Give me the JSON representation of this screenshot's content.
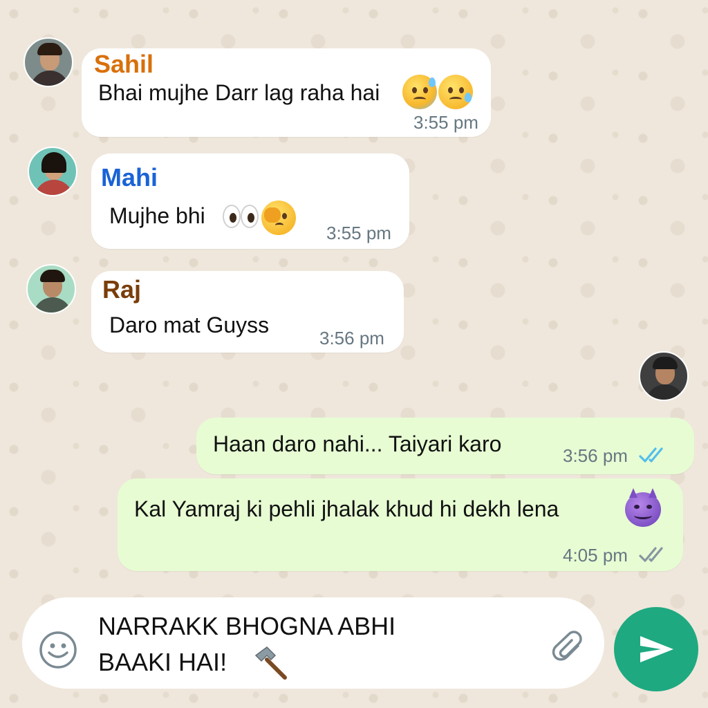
{
  "colors": {
    "chat_background": "#efe7dc",
    "incoming_bubble": "#ffffff",
    "outgoing_bubble": "#e7fcd3",
    "send_button": "#1ea981",
    "read_ticks": "#53bdeb",
    "delivered_ticks": "#8696a0"
  },
  "messages": [
    {
      "direction": "incoming",
      "sender": "Sahil",
      "sender_color": "#d9700a",
      "text": "Bhai mujhe Darr lag raha hai",
      "emoji": [
        "anxious-sweat-face-emoji",
        "worried-sweat-face-emoji"
      ],
      "time": "3:55 pm"
    },
    {
      "direction": "incoming",
      "sender": "Mahi",
      "sender_color": "#1a63d6",
      "text": "Mujhe bhi",
      "emoji": [
        "eyes-emoji",
        "face-with-hand-over-eye-emoji"
      ],
      "time": "3:55 pm"
    },
    {
      "direction": "incoming",
      "sender": "Raj",
      "sender_color": "#7a3d0a",
      "text": "Daro mat Guyss",
      "time": "3:56 pm"
    },
    {
      "direction": "outgoing",
      "text": "Haan daro nahi... Taiyari karo",
      "time": "3:56 pm",
      "ticks": "read"
    },
    {
      "direction": "outgoing",
      "text": "Kal Yamraj ki pehli jhalak khud hi dekh lena",
      "emoji": [
        "smiling-devil-emoji"
      ],
      "time": "4:05 pm",
      "ticks": "delivered"
    }
  ],
  "composer": {
    "text_line1": "NARRAKK BHOGNA ABHI",
    "text_line2": "BAAKI HAI!",
    "trailing_emoji": "hammer-emoji",
    "left_icon": "emoji-smiley-icon",
    "right_icon": "paperclip-icon",
    "send_icon": "send-arrow-icon"
  }
}
